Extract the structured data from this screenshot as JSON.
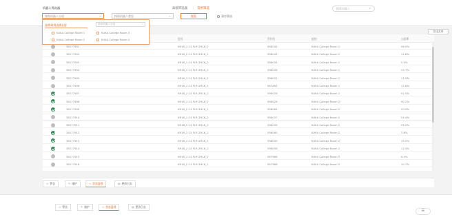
{
  "filter": {
    "robot_group_label": "机器人筛选器",
    "robot_select_placeholder": "按照机器人分组",
    "type_select_placeholder": "按照机器人类型",
    "view_tabs": [
      "高级筛选器",
      "常用筛选"
    ],
    "query_label": "搜索",
    "reset_label": "清空筛选",
    "search_placeholder": "搜索机器人"
  },
  "dropdown": {
    "header": "选择/取消选择全部",
    "search_placeholder": "搜索机器人分组",
    "options": [
      "KUKA College Room 1",
      "KUKA College Room 2",
      "KUKA College Room 3",
      "KUKA College Room 4"
    ]
  },
  "export_label": "导出文件",
  "table": {
    "headers": [
      "",
      "",
      "型号",
      "序列号",
      "组别",
      "占用率"
    ],
    "rows": [
      {
        "status": "idle",
        "name": "38177901",
        "model": "KR16_2 C4 FLR ZH16_2",
        "serial": "598042",
        "group": "KUKA College Room 1",
        "util": "56.9%"
      },
      {
        "status": "idle",
        "name": "38177902",
        "model": "KR16_2 C4 FLR ZH16_2",
        "serial": "598043",
        "group": "KUKA College Room 1",
        "util": "12.8%"
      },
      {
        "status": "idle",
        "name": "38177903",
        "model": "KR16_2 C4 FLR ZH16_2",
        "serial": "598034",
        "group": "KUKA College Room 1",
        "util": "5.5%"
      },
      {
        "status": "idle",
        "name": "38177904",
        "model": "KR16_2 C4 FLR ZH16_2",
        "serial": "598036",
        "group": "KUKA College Room 1",
        "util": "25.7%"
      },
      {
        "status": "idle",
        "name": "38177905",
        "model": "KR16_2 C4 FLR ZH16_2",
        "serial": "598031",
        "group": "KUKA College Room 1",
        "util": "11.9%"
      },
      {
        "status": "idle",
        "name": "38177906",
        "model": "KR16_2 C4 FLR ZH16_2",
        "serial": "587892",
        "group": "KUKA College Room 1",
        "util": "12.8%"
      },
      {
        "status": "ok",
        "name": "38177907",
        "model": "KR16_2 C4 FLR ZH16_2",
        "serial": "598028",
        "group": "KUKA College Room 2",
        "util": "91.5%"
      },
      {
        "status": "ok",
        "name": "38177908",
        "model": "KR16_2 C4 FLR ZH16_2",
        "serial": "598029",
        "group": "KUKA College Room 2",
        "util": "90.2%"
      },
      {
        "status": "ok",
        "name": "38177909",
        "model": "KR16_2 C4 FLR ZH16_2",
        "serial": "598084",
        "group": "KUKA College Room 2",
        "util": "93.9%"
      },
      {
        "status": "idle",
        "name": "38177910",
        "model": "KR16_2 C4 FLR ZH16_2",
        "serial": "598037",
        "group": "KUKA College Room 2",
        "util": "54.4%"
      },
      {
        "status": "idle",
        "name": "38177911",
        "model": "KR16_2 C4 FLR ZH16_2",
        "serial": "598039",
        "group": "KUKA College Room 2",
        "util": "55.2%"
      },
      {
        "status": "ok",
        "name": "38177912",
        "model": "KR16_2 C4 FLR ZH16_2",
        "serial": "598080",
        "group": "KUKA College Room 2",
        "util": "3.8%"
      },
      {
        "status": "ok",
        "name": "38177913",
        "model": "KR16_2 C4 FLR ZH16_2",
        "serial": "598030",
        "group": "KUKA College Room 2",
        "util": "15.5%"
      },
      {
        "status": "ok",
        "name": "38177914",
        "model": "KR16_2 C4 FLR ZH16_2",
        "serial": "598038",
        "group": "KUKA College Room 2",
        "util": "12.4%"
      },
      {
        "status": "idle",
        "name": "38177915",
        "model": "KR16_2 C4 FLR ZH16_2",
        "serial": "587966",
        "group": "KUKA College Room 3",
        "util": "6.4%"
      },
      {
        "status": "idle",
        "name": "38177916",
        "model": "KR16_2 C4 FLR ZH16_2",
        "serial": "587966",
        "group": "KUKA College Room 3",
        "util": "10.7%"
      }
    ]
  },
  "bottom_tabs": [
    "警告",
    "维护",
    "状态监视",
    "更改日志"
  ],
  "lower_tabs": [
    "警告",
    "维护",
    "状态监视",
    "更改日志"
  ],
  "fab_label": "☰"
}
